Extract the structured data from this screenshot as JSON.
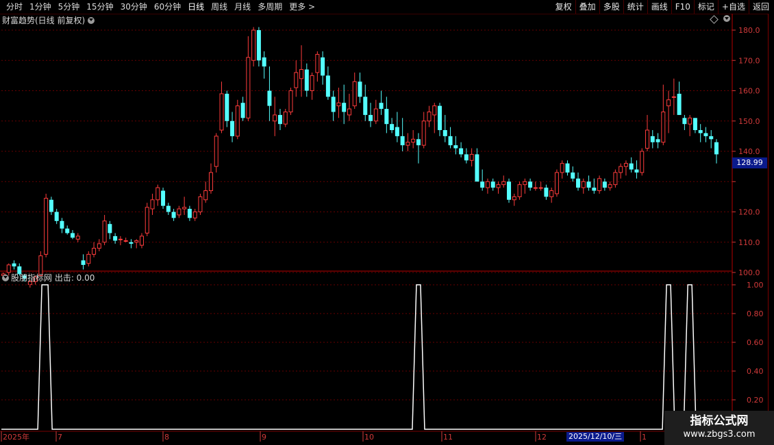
{
  "toolbar": {
    "tabs": [
      "分时",
      "1分钟",
      "5分钟",
      "15分钟",
      "30分钟",
      "60分钟",
      "日线",
      "周线",
      "月线",
      "多周期",
      "更多 >"
    ],
    "buttons": [
      "复权",
      "叠加",
      "多股",
      "统计",
      "画线",
      "F10",
      "标记",
      "+自选",
      "返回"
    ]
  },
  "main_panel": {
    "title": "财富趋势(日线 前复权)"
  },
  "indicator_panel": {
    "title": "股朋指标网 出击: 0.00"
  },
  "price_axis": [
    "180.0",
    "170.0",
    "160.0",
    "150.0",
    "140.0",
    "130.0",
    "120.0",
    "110.0",
    "100.0"
  ],
  "current_price": "128.99",
  "indicator_axis": [
    "1.00",
    "0.80",
    "0.60",
    "0.40",
    "0.20"
  ],
  "date_axis": [
    "2025年",
    "7",
    "8",
    "9",
    "10",
    "11",
    "12",
    "1"
  ],
  "cursor_date": "2025/12/10/三",
  "watermark": {
    "line1": "指标公式网",
    "line2": "www.zbgs3.com"
  },
  "colors": {
    "up": "#ff3c3c",
    "down": "#54ffff",
    "axis": "#d23a3a",
    "grid": "#7a0000",
    "signal": "#ffffff"
  },
  "chart_data": [
    {
      "type": "candlestick",
      "title": "财富趋势(日线 前复权)",
      "ylim": [
        95,
        183
      ],
      "candles": [
        [
          99,
          100,
          98,
          99.5
        ],
        [
          100,
          103,
          99,
          102.5
        ],
        [
          103,
          104,
          101,
          102
        ],
        [
          102,
          103,
          99,
          99.5
        ],
        [
          99,
          99.5,
          97,
          98
        ],
        [
          96,
          97.5,
          95,
          97
        ],
        [
          97,
          99,
          96,
          98.5
        ],
        [
          99,
          107,
          99,
          105.5
        ],
        [
          106,
          126,
          105,
          124.5
        ],
        [
          124,
          125,
          119,
          120
        ],
        [
          120,
          121,
          116,
          117
        ],
        [
          117,
          118,
          113,
          114.5
        ],
        [
          114.5,
          115.5,
          112.5,
          113
        ],
        [
          113,
          114,
          111,
          111.5
        ],
        [
          111,
          113,
          110,
          112
        ],
        [
          104,
          106,
          101,
          102.5
        ],
        [
          103,
          107,
          102,
          106
        ],
        [
          106,
          110,
          105,
          108
        ],
        [
          108,
          111,
          107,
          109.5
        ],
        [
          110,
          119,
          109,
          117
        ],
        [
          116,
          117,
          111,
          113
        ],
        [
          112,
          113,
          109.5,
          110.5
        ],
        [
          111,
          112,
          109,
          111
        ],
        [
          110.5,
          111.5,
          110,
          110.5
        ],
        [
          110,
          111,
          108,
          109.5
        ],
        [
          110,
          111,
          108,
          110.5
        ],
        [
          109,
          113,
          108,
          112
        ],
        [
          113,
          123,
          112,
          121.5
        ],
        [
          121,
          126,
          119,
          124
        ],
        [
          124,
          129,
          122,
          128
        ],
        [
          127,
          128,
          121,
          122
        ],
        [
          122,
          123,
          119,
          120
        ],
        [
          120,
          121,
          117,
          118
        ],
        [
          119,
          122,
          118,
          121
        ],
        [
          121,
          125,
          119,
          121.5
        ],
        [
          121,
          122,
          117,
          118
        ],
        [
          118,
          121,
          117,
          120
        ],
        [
          120,
          126,
          119,
          125
        ],
        [
          124,
          130,
          123,
          127
        ],
        [
          127,
          136,
          126,
          133
        ],
        [
          135,
          146,
          133,
          145
        ],
        [
          147,
          163,
          146,
          159
        ],
        [
          159,
          160,
          148,
          150
        ],
        [
          150,
          153,
          143,
          145
        ],
        [
          145,
          157,
          144,
          155
        ],
        [
          156,
          158,
          150,
          151
        ],
        [
          151,
          178,
          150,
          171
        ],
        [
          170,
          181,
          168,
          180
        ],
        [
          180,
          181,
          168,
          170
        ],
        [
          171,
          173,
          164,
          168
        ],
        [
          160,
          168,
          150,
          155
        ],
        [
          150,
          158,
          145,
          152
        ],
        [
          152,
          154,
          147,
          149
        ],
        [
          149,
          154,
          148,
          153
        ],
        [
          153,
          161,
          152,
          160
        ],
        [
          161,
          170,
          158,
          166
        ],
        [
          164,
          175,
          158,
          167
        ],
        [
          167,
          169,
          158,
          160
        ],
        [
          160,
          166,
          157,
          165
        ],
        [
          166,
          173,
          163,
          172
        ],
        [
          171,
          173,
          162,
          165
        ],
        [
          165,
          168,
          157,
          158
        ],
        [
          158,
          160,
          150,
          153
        ],
        [
          155,
          161,
          151,
          156
        ],
        [
          156,
          162,
          149,
          153
        ],
        [
          152,
          159,
          150,
          154
        ],
        [
          155,
          166,
          154,
          163
        ],
        [
          163,
          166,
          156,
          158
        ],
        [
          158,
          162,
          150,
          152
        ],
        [
          152,
          156,
          148,
          150
        ],
        [
          150,
          157,
          149,
          154
        ],
        [
          156,
          160,
          152,
          154
        ],
        [
          154,
          158,
          146,
          149
        ],
        [
          149,
          151,
          146,
          147
        ],
        [
          148,
          153,
          143,
          145
        ],
        [
          145,
          151,
          140,
          142
        ],
        [
          142,
          146,
          140,
          143
        ],
        [
          143,
          147,
          141,
          144
        ],
        [
          144,
          146,
          136,
          142
        ],
        [
          142,
          153,
          141,
          150
        ],
        [
          150,
          155,
          148,
          153
        ],
        [
          152,
          156,
          146,
          155
        ],
        [
          155,
          156,
          145,
          147
        ],
        [
          147,
          152,
          143,
          145
        ],
        [
          145,
          148,
          141,
          142
        ],
        [
          142,
          145,
          139,
          141
        ],
        [
          141,
          143,
          138,
          139
        ],
        [
          139,
          141,
          136,
          137
        ],
        [
          137,
          141,
          135,
          139
        ],
        [
          139,
          141,
          131,
          130
        ],
        [
          130,
          134,
          127,
          128
        ],
        [
          128,
          131,
          126,
          130
        ],
        [
          130,
          131,
          127,
          128
        ],
        [
          128,
          130,
          126,
          129
        ],
        [
          129,
          132,
          128,
          130
        ],
        [
          130,
          131,
          123,
          124
        ],
        [
          124,
          126,
          122,
          125
        ],
        [
          125,
          130,
          124,
          129
        ],
        [
          129,
          131,
          126,
          130
        ],
        [
          130,
          131,
          127,
          128
        ],
        [
          128,
          130,
          127,
          128
        ],
        [
          128,
          130,
          127,
          128
        ],
        [
          128,
          129,
          124,
          125
        ],
        [
          125,
          128,
          123,
          127
        ],
        [
          126,
          134,
          125,
          133
        ],
        [
          133,
          137,
          131,
          136
        ],
        [
          136,
          137,
          132,
          133
        ],
        [
          133,
          135,
          130,
          131
        ],
        [
          131,
          133,
          127,
          128
        ],
        [
          128,
          131,
          126,
          130
        ],
        [
          130,
          132,
          127,
          128
        ],
        [
          128,
          131,
          126,
          127
        ],
        [
          127,
          132,
          126,
          131
        ],
        [
          130,
          131,
          127,
          128
        ],
        [
          128,
          130,
          127,
          129
        ],
        [
          129,
          134,
          128,
          133
        ],
        [
          133,
          136,
          131,
          135
        ],
        [
          135,
          137,
          132,
          136
        ],
        [
          136,
          138,
          133,
          134
        ],
        [
          134,
          137,
          131,
          133
        ],
        [
          133,
          141,
          132,
          140
        ],
        [
          141,
          152,
          140,
          147
        ],
        [
          145,
          147,
          141,
          143
        ],
        [
          144,
          146,
          141,
          143
        ],
        [
          143,
          162,
          142,
          153
        ],
        [
          155,
          160,
          146,
          157
        ],
        [
          158,
          164,
          152,
          158
        ],
        [
          159,
          163,
          152,
          152
        ],
        [
          151,
          152,
          147,
          149
        ],
        [
          149,
          152,
          145,
          151
        ],
        [
          151,
          151,
          146,
          147
        ],
        [
          147,
          149,
          143,
          146
        ],
        [
          146,
          148,
          143,
          145
        ],
        [
          145,
          147,
          141,
          144
        ],
        [
          143,
          144,
          136,
          139
        ]
      ]
    },
    {
      "type": "line",
      "title": "股朋指标网 出击: 0.00",
      "ylim": [
        0,
        1
      ],
      "series": [
        {
          "name": "出击",
          "pulses_at_candle_index": [
            8,
            78,
            125,
            129
          ]
        }
      ]
    }
  ]
}
